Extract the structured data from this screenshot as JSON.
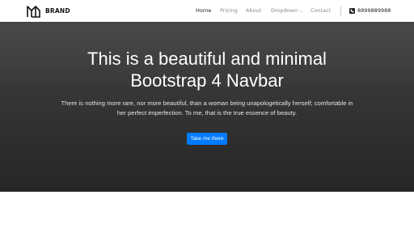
{
  "nav": {
    "brand": "BRAND",
    "links": [
      {
        "label": "Home",
        "active": true
      },
      {
        "label": "Pricing",
        "active": false
      },
      {
        "label": "About",
        "active": false
      },
      {
        "label": "Dropdown",
        "active": false
      },
      {
        "label": "Contact",
        "active": false
      }
    ],
    "phone": "8899889988"
  },
  "hero": {
    "title_line1": "This is a beautiful and minimal",
    "title_line2": "Bootstrap 4 Navbar",
    "text_line1": "There is nothing more rare, nor more beautiful, than a woman being unapologetically herself; comfortable in",
    "text_line2": "her perfect imperfection. To me, that is the true essence of beauty.",
    "button_label": "Take me there"
  },
  "colors": {
    "accent": "#007bff",
    "hero_top": "#4a4a4a",
    "hero_bottom": "#262626"
  }
}
